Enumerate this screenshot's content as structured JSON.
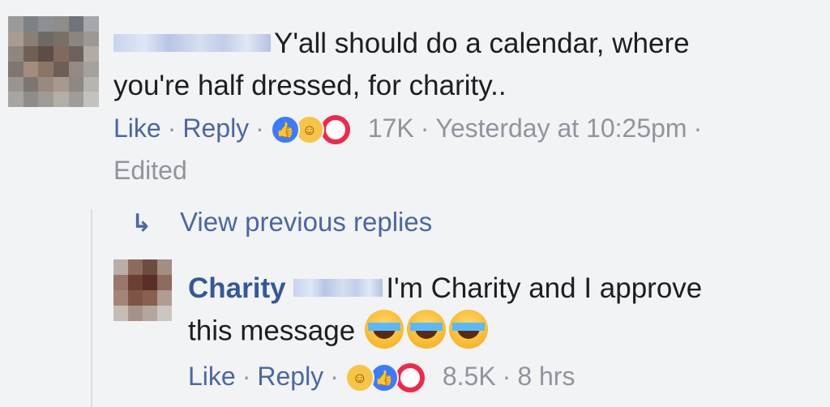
{
  "main_comment": {
    "text_line1": "Y'all should do a calendar, where",
    "text_line2": "you're half dressed, for charity..",
    "like_label": "Like",
    "reply_label": "Reply",
    "reaction_count": "17K",
    "timestamp": "Yesterday at 10:25pm",
    "edited_label": "Edited",
    "separator": "·",
    "reactions": [
      "like-icon",
      "haha-icon",
      "wow-icon"
    ]
  },
  "replies": {
    "view_previous_label": "View previous replies",
    "arrow_icon": "reply-arrow-icon"
  },
  "reply_comment": {
    "author_first_name": "Charity",
    "text_line1": "I'm Charity and I approve",
    "text_line2": "this message",
    "emojis": [
      "tears-of-joy-icon",
      "tears-of-joy-icon",
      "tears-of-joy-icon"
    ],
    "like_label": "Like",
    "reply_label": "Reply",
    "reaction_count": "8.5K",
    "timestamp": "8 hrs",
    "separator": "·",
    "reactions": [
      "haha-icon",
      "like-icon",
      "wow-icon"
    ]
  },
  "colors": {
    "background": "#f2f3f5",
    "link": "#4b67a1",
    "name": "#365899",
    "meta": "#90949c",
    "like_blue": "#3b7bff",
    "haha_yellow": "#f7c545",
    "wow_red": "#f0284a"
  }
}
